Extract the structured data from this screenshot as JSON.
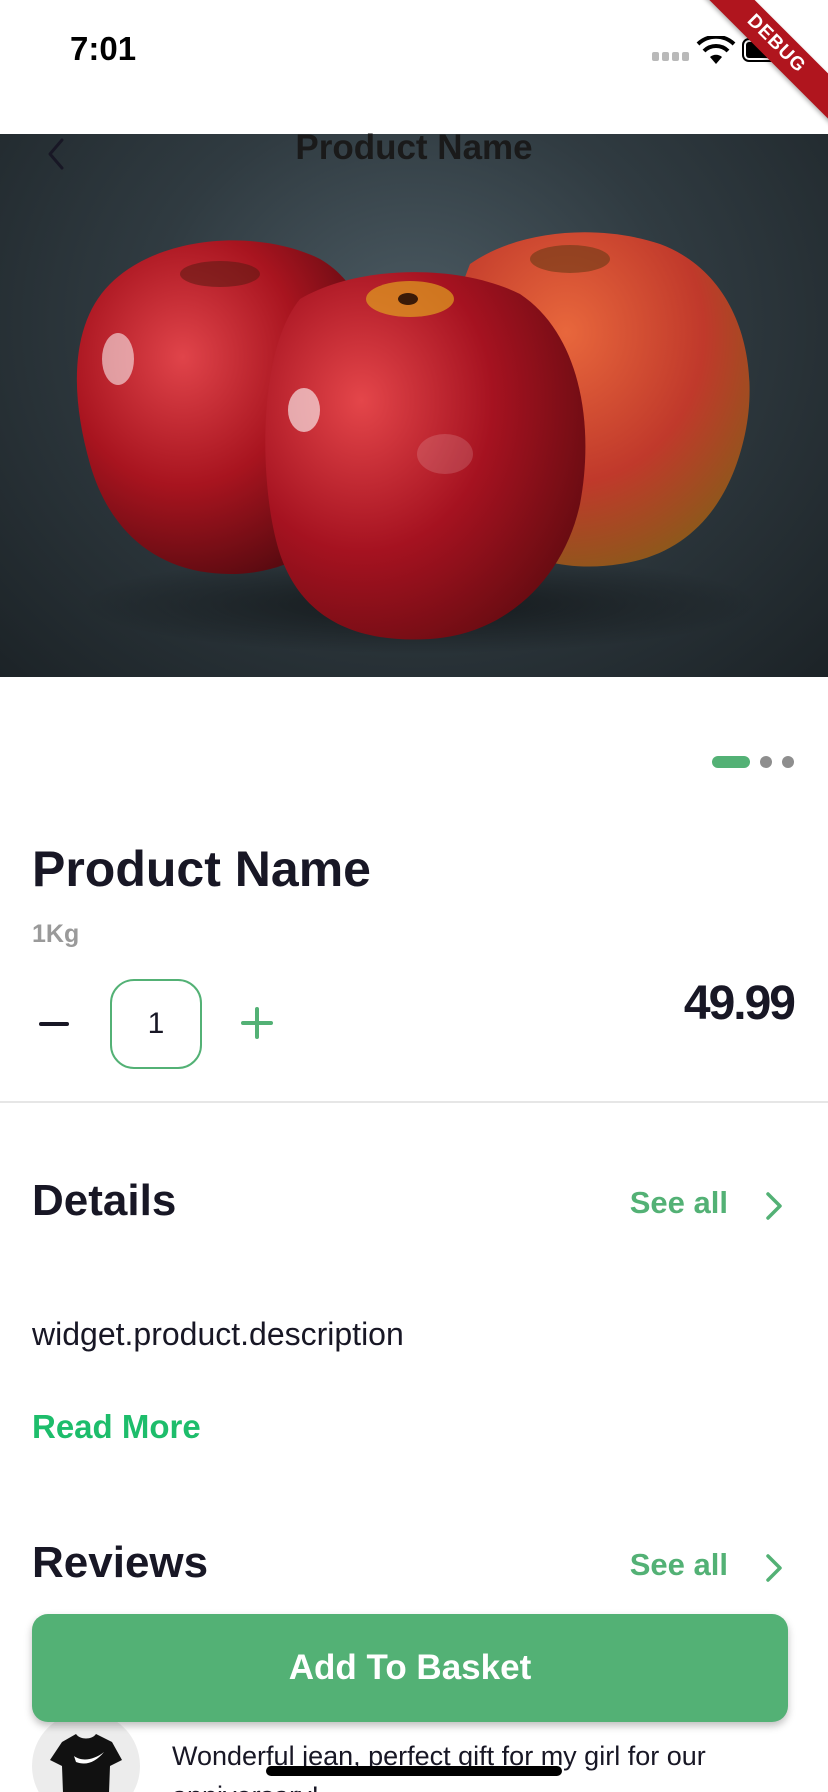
{
  "status_bar": {
    "time": "7:01",
    "debug_label": "DEBUG"
  },
  "app_bar": {
    "title": "Product Name"
  },
  "product": {
    "name": "Product Name",
    "unit": "1Kg",
    "quantity": "1",
    "price": "49.99"
  },
  "carousel": {
    "total": 3,
    "active_index": 0
  },
  "details": {
    "title": "Details",
    "see_all_label": "See all",
    "description": "widget.product.description",
    "read_more_label": "Read More"
  },
  "reviews": {
    "title": "Reviews",
    "see_all_label": "See all",
    "items": [
      {
        "text": "Wonderful jean, perfect gift for my girl for our anniversary!"
      }
    ]
  },
  "actions": {
    "add_to_basket_label": "Add To Basket"
  },
  "icons": {
    "back": "chevron-left-icon",
    "see_all_details": "chevron-right-icon",
    "see_all_reviews": "chevron-right-icon",
    "decrement": "minus-icon",
    "increment": "plus-icon"
  },
  "colors": {
    "accent": "#53b175",
    "read_more": "#1dbd6b",
    "text_primary": "#181725",
    "text_secondary": "#9a9a9a",
    "debug_ribbon": "#b0151e"
  }
}
